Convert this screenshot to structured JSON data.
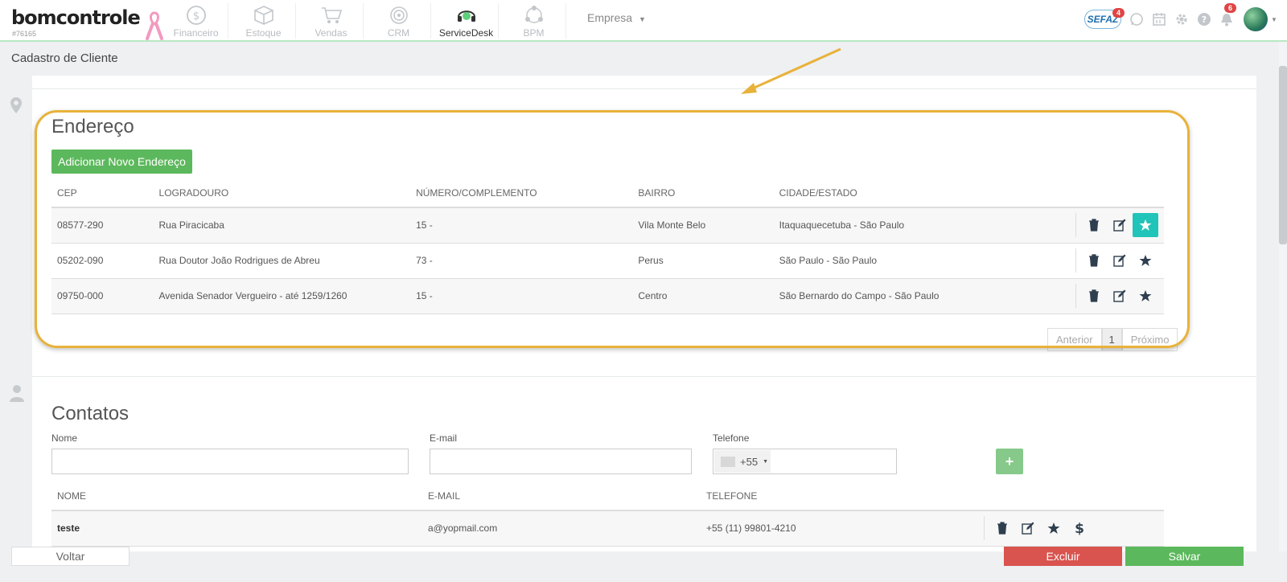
{
  "brand": {
    "name": "bomcontrole",
    "code": "#76165"
  },
  "nav": {
    "modules": [
      {
        "label": "Financeiro",
        "icon": "dollar-coin-icon"
      },
      {
        "label": "Estoque",
        "icon": "box-icon"
      },
      {
        "label": "Vendas",
        "icon": "cart-icon"
      },
      {
        "label": "CRM",
        "icon": "target-icon"
      },
      {
        "label": "ServiceDesk",
        "icon": "headset-icon"
      },
      {
        "label": "BPM",
        "icon": "process-icon"
      }
    ],
    "empresa": "Empresa",
    "sefaz": {
      "label": "SEFAZ",
      "badge": "4"
    },
    "notifications_badge": "6"
  },
  "page": {
    "title": "Cadastro de Cliente"
  },
  "endereco": {
    "title": "Endereço",
    "add_button": "Adicionar Novo Endereço",
    "columns": [
      "CEP",
      "LOGRADOURO",
      "NÚMERO/COMPLEMENTO",
      "BAIRRO",
      "CIDADE/ESTADO"
    ],
    "rows": [
      {
        "cep": "08577-290",
        "logradouro": "Rua Piracicaba",
        "numero": "15 -",
        "bairro": "Vila Monte Belo",
        "cidade": "Itaquaquecetuba - São Paulo",
        "favorite": true
      },
      {
        "cep": "05202-090",
        "logradouro": "Rua Doutor João Rodrigues de Abreu",
        "numero": "73 -",
        "bairro": "Perus",
        "cidade": "São Paulo - São Paulo",
        "favorite": false
      },
      {
        "cep": "09750-000",
        "logradouro": "Avenida Senador Vergueiro - até 1259/1260",
        "numero": "15 -",
        "bairro": "Centro",
        "cidade": "São Bernardo do Campo - São Paulo",
        "favorite": false
      }
    ],
    "pager": {
      "prev": "Anterior",
      "current": "1",
      "next": "Próximo"
    }
  },
  "contatos": {
    "title": "Contatos",
    "fields": {
      "nome_label": "Nome",
      "nome_value": "",
      "email_label": "E-mail",
      "email_value": "",
      "telefone_label": "Telefone",
      "ddi": "+55",
      "telefone_value": ""
    },
    "add_button": "+",
    "columns": [
      "NOME",
      "E-MAIL",
      "TELEFONE"
    ],
    "rows": [
      {
        "nome": "teste",
        "email": "a@yopmail.com",
        "telefone": "+55 (11) 99801-4210"
      }
    ]
  },
  "footer": {
    "back": "Voltar",
    "delete": "Excluir",
    "save": "Salvar"
  },
  "colors": {
    "green": "#5cb85c",
    "red": "#d9534f",
    "teal": "#21c4b8",
    "highlight": "#e8b23a"
  }
}
